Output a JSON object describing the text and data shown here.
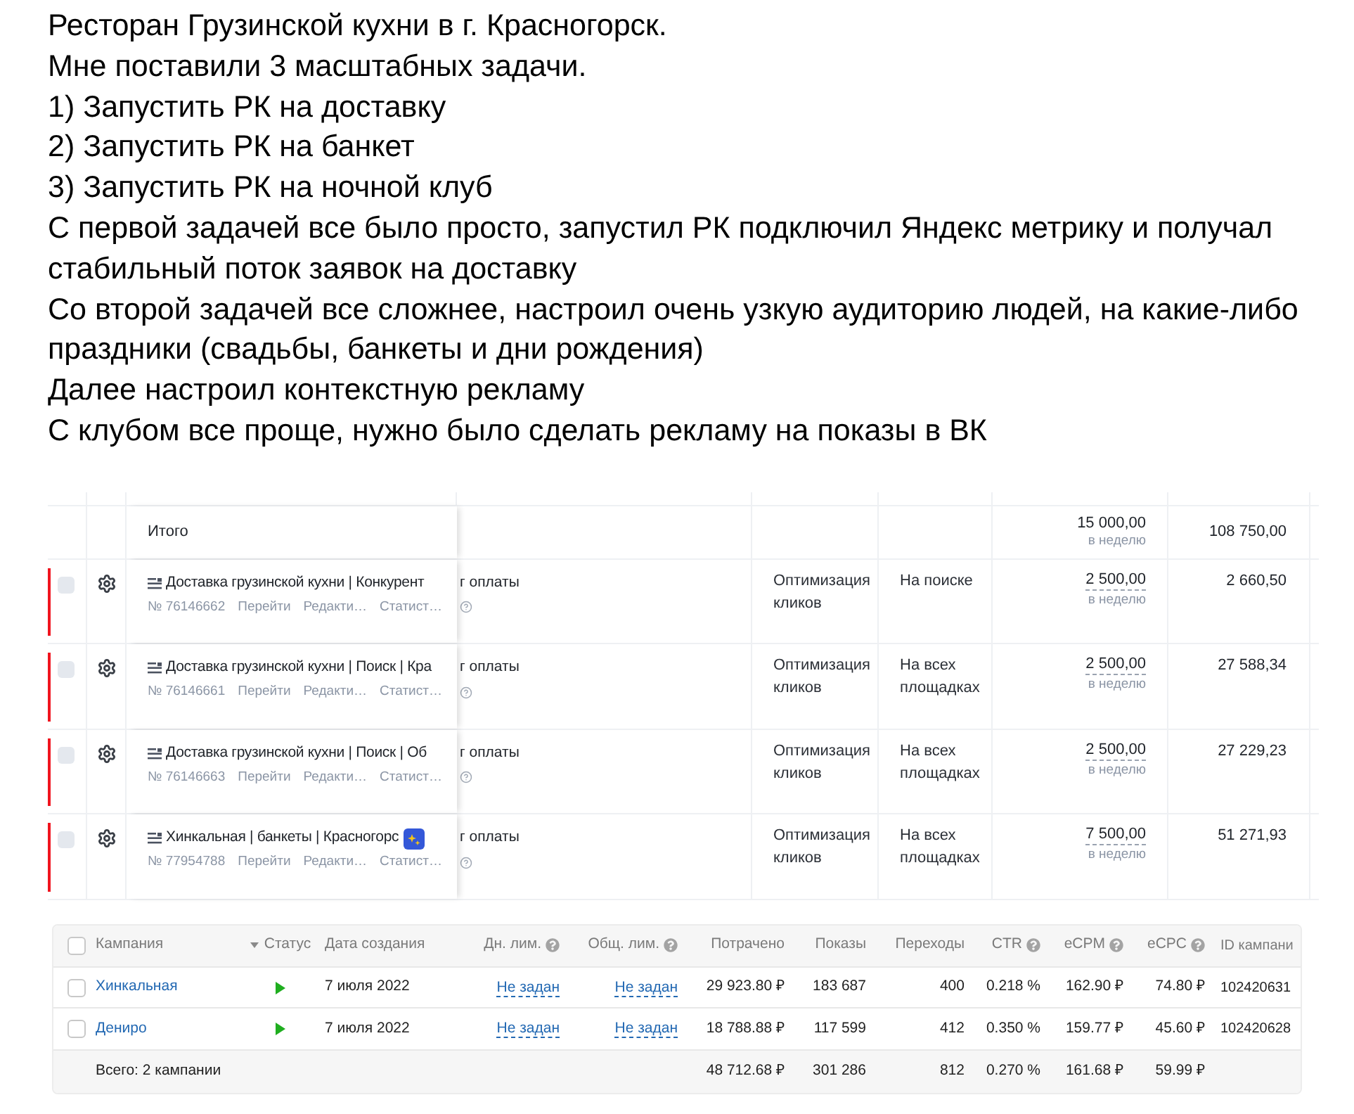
{
  "document": {
    "paragraphs": [
      "Ресторан Грузинской кухни в г. Красногорск.",
      "Мне поставили 3 масштабных задачи.",
      "1) Запустить РК на доставку",
      "2) Запустить РК на банкет",
      "3) Запустить РК на ночной клуб",
      "С первой задачей все было просто, запустил РК подключил Яндекс метрику и получал стабильный поток заявок на доставку",
      "Со второй задачей все сложнее, настроил очень узкую аудиторию людей, на какие-либо праздники (свадьбы, банкеты и дни рождения)",
      "Далее настроил контекстную рекламу",
      "С клубом все проще, нужно было сделать рекламу на показы в ВК"
    ]
  },
  "campaigns": {
    "total": {
      "label": "Итого",
      "budget": "15 000,00",
      "budget_period": "в неделю",
      "spent": "108 750,00"
    },
    "rows": [
      {
        "flagged": true,
        "checked": false,
        "name": "Доставка грузинской кухни | Конкурент",
        "badge": false,
        "tail": "г оплаты",
        "number": "№ 76146662",
        "links": [
          "Перейти",
          "Редакти…",
          "Статист…"
        ],
        "strategy": "Оптимизация кликов",
        "placement": "На поиске",
        "budget": "2 500,00",
        "budget_period": "в неделю",
        "spent": "2 660,50"
      },
      {
        "flagged": true,
        "checked": false,
        "name": "Доставка грузинской кухни | Поиск | Кра",
        "badge": false,
        "tail": "г оплаты",
        "number": "№ 76146661",
        "links": [
          "Перейти",
          "Редакти…",
          "Статист…"
        ],
        "strategy": "Оптимизация кликов",
        "placement": "На всех площадках",
        "budget": "2 500,00",
        "budget_period": "в неделю",
        "spent": "27 588,34"
      },
      {
        "flagged": true,
        "checked": false,
        "name": "Доставка грузинской кухни | Поиск | Об",
        "badge": false,
        "tail": "г оплаты",
        "number": "№ 76146663",
        "links": [
          "Перейти",
          "Редакти…",
          "Статист…"
        ],
        "strategy": "Оптимизация кликов",
        "placement": "На всех площадках",
        "budget": "2 500,00",
        "budget_period": "в неделю",
        "spent": "27 229,23"
      },
      {
        "flagged": true,
        "checked": false,
        "name": "Хинкальная | банкеты | Красногорс",
        "badge": true,
        "tail": "г оплаты",
        "number": "№ 77954788",
        "links": [
          "Перейти",
          "Редакти…",
          "Статист…"
        ],
        "strategy": "Оптимизация кликов",
        "placement": "На всех площадках",
        "budget": "7 500,00",
        "budget_period": "в неделю",
        "spent": "51 271,93"
      }
    ]
  },
  "stats": {
    "header_checked": false,
    "columns": [
      {
        "label": "Кампания",
        "sorted": false,
        "help": false
      },
      {
        "label": "Статус",
        "sorted": true,
        "help": false
      },
      {
        "label": "Дата создания",
        "sorted": false,
        "help": false
      },
      {
        "label": "Дн. лим.",
        "sorted": false,
        "help": true
      },
      {
        "label": "Общ. лим.",
        "sorted": false,
        "help": true
      },
      {
        "label": "Потрачено",
        "sorted": false,
        "help": false
      },
      {
        "label": "Показы",
        "sorted": false,
        "help": false
      },
      {
        "label": "Переходы",
        "sorted": false,
        "help": false
      },
      {
        "label": "CTR",
        "sorted": false,
        "help": true
      },
      {
        "label": "eCPM",
        "sorted": false,
        "help": true
      },
      {
        "label": "eCPC",
        "sorted": false,
        "help": true
      },
      {
        "label": "ID кампани",
        "sorted": false,
        "help": false
      }
    ],
    "rows": [
      {
        "checked": false,
        "name": "Хинкальная",
        "running": true,
        "created": "7 июля 2022",
        "daily_limit": "Не задан",
        "total_limit": "Не задан",
        "spent": "29 923.80 ₽",
        "impressions": "183 687",
        "clicks": "400",
        "ctr": "0.218 %",
        "ecpm": "162.90 ₽",
        "ecpc": "74.80 ₽",
        "id": "102420631"
      },
      {
        "checked": false,
        "name": "Дениро",
        "running": true,
        "created": "7 июля 2022",
        "daily_limit": "Не задан",
        "total_limit": "Не задан",
        "spent": "18 788.88 ₽",
        "impressions": "117 599",
        "clicks": "412",
        "ctr": "0.350 %",
        "ecpm": "159.77 ₽",
        "ecpc": "45.60 ₽",
        "id": "102420628"
      }
    ],
    "total": {
      "label": "Всего: 2 кампании",
      "spent": "48 712.68 ₽",
      "impressions": "301 286",
      "clicks": "812",
      "ctr": "0.270 %",
      "ecpm": "161.68 ₽",
      "ecpc": "59.99 ₽"
    }
  }
}
